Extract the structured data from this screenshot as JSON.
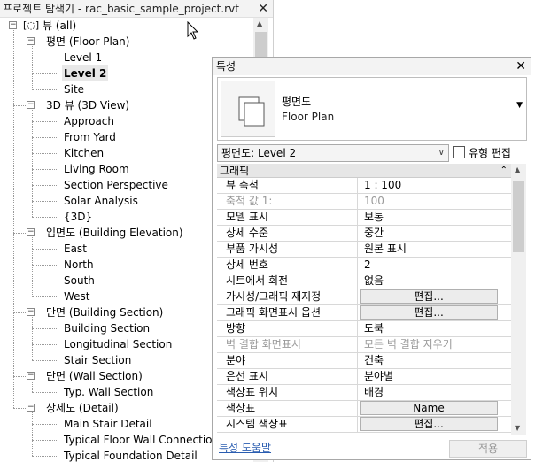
{
  "browser": {
    "title": "프로젝트 탐색기 - rac_basic_sample_project.rvt",
    "root": "뷰 (all)",
    "groups": [
      {
        "label": "평면 (Floor Plan)",
        "items": [
          "Level 1",
          "Level 2",
          "Site"
        ],
        "selected": 1
      },
      {
        "label": "3D 뷰 (3D View)",
        "items": [
          "Approach",
          "From Yard",
          "Kitchen",
          "Living Room",
          "Section Perspective",
          "Solar Analysis",
          "{3D}"
        ]
      },
      {
        "label": "입면도 (Building Elevation)",
        "items": [
          "East",
          "North",
          "South",
          "West"
        ]
      },
      {
        "label": "단면 (Building Section)",
        "items": [
          "Building Section",
          "Longitudinal Section",
          "Stair Section"
        ]
      },
      {
        "label": "단면 (Wall Section)",
        "items": [
          "Typ. Wall Section"
        ]
      },
      {
        "label": "상세도 (Detail)",
        "items": [
          "Main Stair Detail",
          "Typical Floor Wall Connection",
          "Typical Foundation Detail"
        ]
      }
    ]
  },
  "properties": {
    "title": "특성",
    "type_name": "평면도",
    "type_name_en": "Floor Plan",
    "instance_selector": "평면도: Level 2",
    "edit_type": "유형 편집",
    "category": "그래픽",
    "rows": [
      {
        "name": "뷰 축척",
        "value": "1 : 100"
      },
      {
        "name": "축척 값   1:",
        "value": "100",
        "dim": true
      },
      {
        "name": "모델 표시",
        "value": "보통"
      },
      {
        "name": "상세 수준",
        "value": "중간"
      },
      {
        "name": "부품 가시성",
        "value": "원본 표시"
      },
      {
        "name": "상세 번호",
        "value": "2"
      },
      {
        "name": "시트에서 회전",
        "value": "없음"
      },
      {
        "name": "가시성/그래픽 재지정",
        "value": "편집...",
        "button": true
      },
      {
        "name": "그래픽 화면표시 옵션",
        "value": "편집...",
        "button": true
      },
      {
        "name": "방향",
        "value": "도북"
      },
      {
        "name": "벽 결합 화면표시",
        "value": "모든 벽 결합 지우기",
        "dim": true
      },
      {
        "name": "분야",
        "value": "건축"
      },
      {
        "name": "은선 표시",
        "value": "분야별"
      },
      {
        "name": "색상표 위치",
        "value": "배경"
      },
      {
        "name": "색상표",
        "value": "Name",
        "button": true
      },
      {
        "name": "시스템 색상표",
        "value": "편집...",
        "button": true
      }
    ],
    "help_link": "특성 도움말",
    "apply_button": "적용"
  }
}
